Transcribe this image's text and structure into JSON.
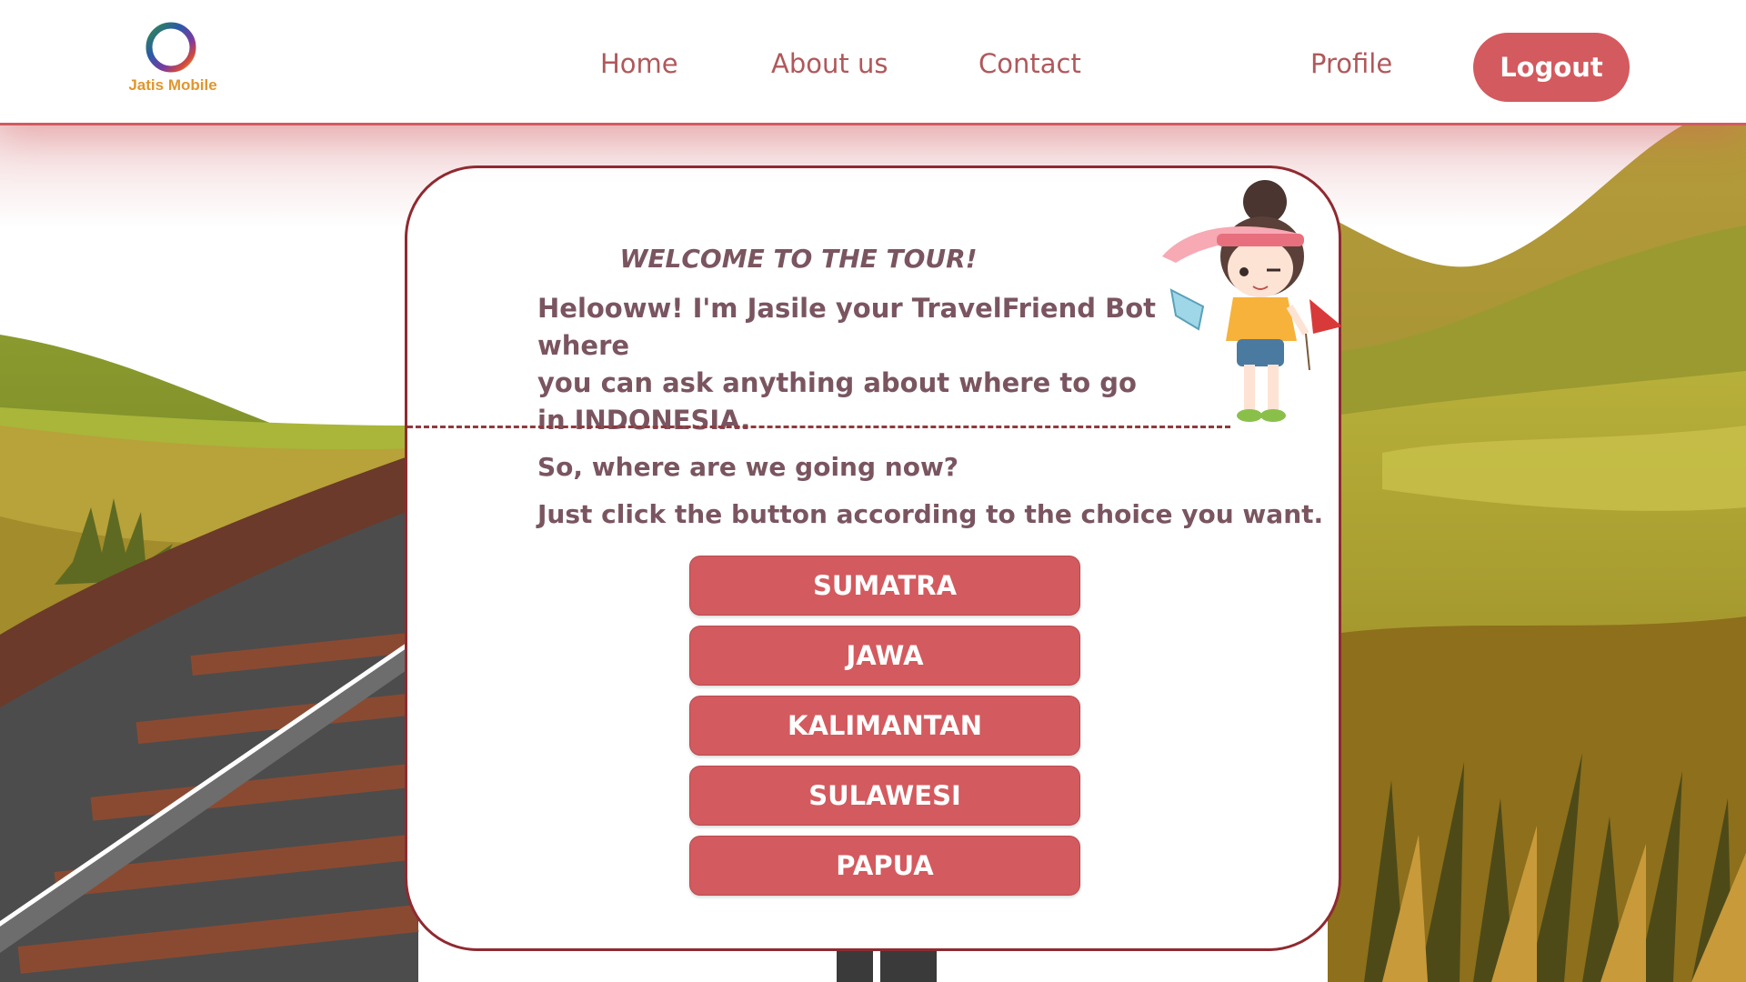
{
  "logo": {
    "text": "Jatis Mobile"
  },
  "nav": {
    "home": "Home",
    "about": "About us",
    "contact": "Contact",
    "profile": "Profile",
    "logout": "Logout"
  },
  "card": {
    "title": "WELCOME TO THE TOUR!",
    "intro_line1": "Helooww! I'm Jasile your TravelFriend Bot where",
    "intro_line2": "you can ask anything about where to go",
    "intro_line3": "in INDONESIA.",
    "question": "So, where are we going now?",
    "instruction": "Just click the button according to the choice you want.",
    "choices": [
      "SUMATRA",
      "JAWA",
      "KALIMANTAN",
      "SULAWESI",
      "PAPUA"
    ]
  },
  "colors": {
    "accent": "#d35a5e",
    "border": "#8f2a30",
    "text": "#7a5560"
  }
}
